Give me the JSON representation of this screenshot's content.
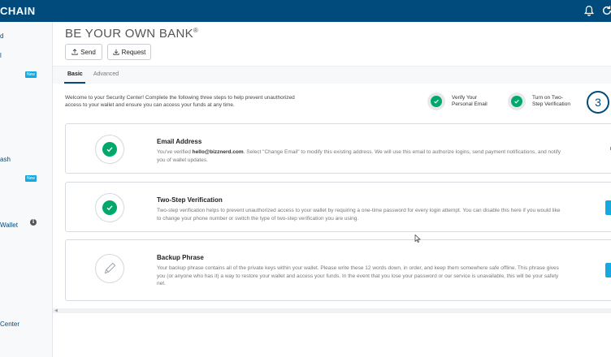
{
  "brand": "CHAIN",
  "topbar": {
    "icons": [
      "bell-icon",
      "refresh-icon"
    ]
  },
  "sidebar": {
    "items": [
      {
        "label": "d"
      },
      {
        "label": "l"
      },
      {
        "label": "ash"
      },
      {
        "label": "Wallet"
      },
      {
        "label": "Center"
      }
    ],
    "badge_1": "New",
    "badge_2": "New",
    "info_glyph": "i"
  },
  "main": {
    "title": "BE YOUR OWN BANK",
    "title_mark": "®",
    "send_label": "Send",
    "request_label": "Request",
    "tabs": [
      {
        "label": "Basic",
        "active": true
      },
      {
        "label": "Advanced",
        "active": false
      }
    ],
    "welcome_text": "Welcome to your Security Center! Complete the following three steps to help prevent unauthorized access to your wallet and ensure you can access your funds at any time.",
    "steps": [
      {
        "label_line1": "Verify Your",
        "label_line2": "Personal Email",
        "done": true
      },
      {
        "label_line1": "Turn on Two-",
        "label_line2": "Step Verification",
        "done": true
      },
      {
        "number": "3"
      }
    ],
    "cards": [
      {
        "title": "Email Address",
        "desc_before": "You've verified ",
        "desc_email": "hello@bizznerd.com",
        "desc_after": ". Select \"Change Email\" to modify this existing address. We will use this email to authorize logins, send payment notifications, and notify you of wallet updates.",
        "icon": "check-icon"
      },
      {
        "title": "Two-Step Verification",
        "desc": "Two-step verification helps to prevent unauthorized access to your wallet by requiring a one-time password for every login attempt. You can disable this here if you would like to change your phone number or switch the type of two-step verification you are using.",
        "icon": "check-icon"
      },
      {
        "title": "Backup Phrase",
        "desc": "Your backup phrase contains all of the private keys within your wallet. Please write these 12 words down, in order, and keep them somewhere safe offline. This phrase gives you (or anyone who has it) a way to restore your wallet and access your funds. In the event that you lose your password or our service is unavailable, this will be your safety net.",
        "icon": "pencil-icon"
      }
    ]
  },
  "colors": {
    "topbar": "#004a7c",
    "accent": "#14a9e0",
    "success": "#00a86b"
  }
}
